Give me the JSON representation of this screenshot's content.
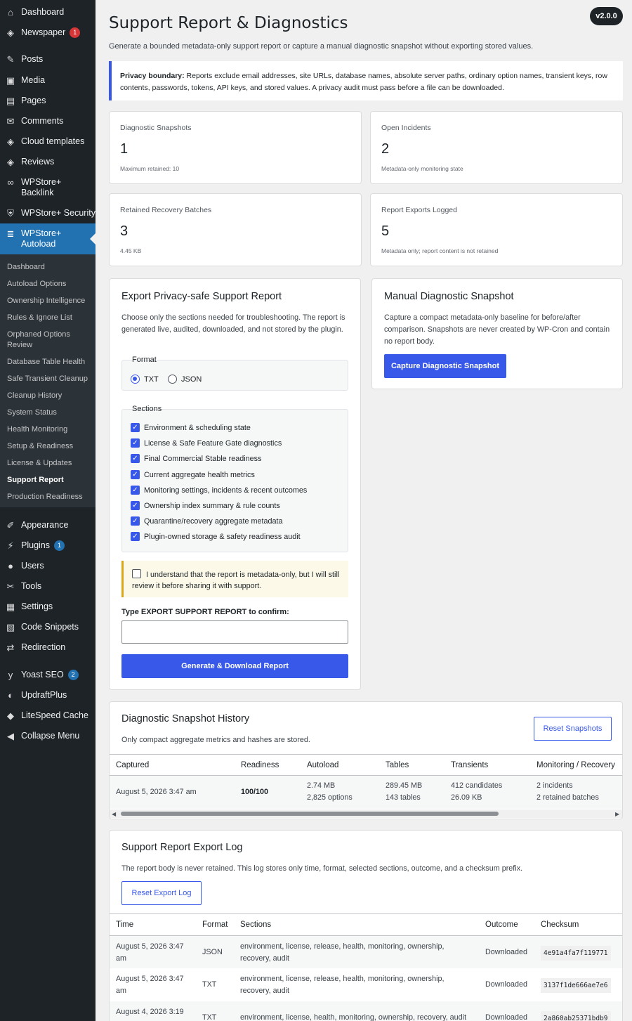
{
  "sidebar": {
    "top_items": [
      {
        "label": "Dashboard",
        "icon": "dashboard-icon",
        "glyph": "⌂"
      },
      {
        "label": "Newspaper",
        "icon": "diamond-icon",
        "glyph": "◈",
        "badge": "1"
      },
      {
        "label": "Posts",
        "icon": "pin-icon",
        "glyph": "✎"
      },
      {
        "label": "Media",
        "icon": "media-icon",
        "glyph": "▣"
      },
      {
        "label": "Pages",
        "icon": "page-icon",
        "glyph": "▤"
      },
      {
        "label": "Comments",
        "icon": "comment-icon",
        "glyph": "✉"
      },
      {
        "label": "Cloud templates",
        "icon": "diamond-icon",
        "glyph": "◈"
      },
      {
        "label": "Reviews",
        "icon": "diamond-icon",
        "glyph": "◈"
      },
      {
        "label": "WPStore+ Backlink",
        "icon": "link-icon",
        "glyph": "∞"
      },
      {
        "label": "WPStore+ Security",
        "icon": "shield-icon",
        "glyph": "⛨"
      },
      {
        "label": "WPStore+ Autoload",
        "icon": "database-icon",
        "glyph": "≣"
      }
    ],
    "submenu": [
      "Dashboard",
      "Autoload Options",
      "Ownership Intelligence",
      "Rules & Ignore List",
      "Orphaned Options Review",
      "Database Table Health",
      "Safe Transient Cleanup",
      "Cleanup History",
      "System Status",
      "Health Monitoring",
      "Setup & Readiness",
      "License & Updates",
      "Support Report",
      "Production Readiness"
    ],
    "bottom_items": [
      {
        "label": "Appearance",
        "icon": "brush-icon",
        "glyph": "✐"
      },
      {
        "label": "Plugins",
        "icon": "plug-icon",
        "glyph": "⚡",
        "badge": "1"
      },
      {
        "label": "Users",
        "icon": "user-icon",
        "glyph": "●"
      },
      {
        "label": "Tools",
        "icon": "wrench-icon",
        "glyph": "✂"
      },
      {
        "label": "Settings",
        "icon": "settings-icon",
        "glyph": "▦"
      },
      {
        "label": "Code Snippets",
        "icon": "code-icon",
        "glyph": "▧"
      },
      {
        "label": "Redirection",
        "icon": "redirect-icon",
        "glyph": "⇄"
      },
      {
        "label": "Yoast SEO",
        "icon": "yoast-icon",
        "glyph": "y",
        "badge": "2"
      },
      {
        "label": "UpdraftPlus",
        "icon": "updraft-icon",
        "glyph": "◐"
      },
      {
        "label": "LiteSpeed Cache",
        "icon": "litespeed-icon",
        "glyph": "◆"
      },
      {
        "label": "Collapse Menu",
        "icon": "collapse-icon",
        "glyph": "◀"
      }
    ]
  },
  "header": {
    "title": "Support Report & Diagnostics",
    "version": "v2.0.0",
    "subtitle": "Generate a bounded metadata-only support report or capture a manual diagnostic snapshot without exporting stored values."
  },
  "notice": {
    "bold": "Privacy boundary:",
    "text": " Reports exclude email addresses, site URLs, database names, absolute server paths, ordinary option names, transient keys, row contents, passwords, tokens, API keys, and stored values. A privacy audit must pass before a file can be downloaded."
  },
  "stats": [
    {
      "label": "Diagnostic Snapshots",
      "value": "1",
      "note": "Maximum retained: 10"
    },
    {
      "label": "Open Incidents",
      "value": "2",
      "note": "Metadata-only monitoring state"
    },
    {
      "label": "Retained Recovery Batches",
      "value": "3",
      "note": "4.45 KB"
    },
    {
      "label": "Report Exports Logged",
      "value": "5",
      "note": "Metadata only; report content is not retained"
    }
  ],
  "export": {
    "title": "Export Privacy-safe Support Report",
    "desc": "Choose only the sections needed for troubleshooting. The report is generated live, audited, downloaded, and not stored by the plugin.",
    "format_legend": "Format",
    "format_options": [
      "TXT",
      "JSON"
    ],
    "sections_legend": "Sections",
    "sections": [
      "Environment & scheduling state",
      "License & Safe Feature Gate diagnostics",
      "Final Commercial Stable readiness",
      "Current aggregate health metrics",
      "Monitoring settings, incidents & recent outcomes",
      "Ownership index summary & rule counts",
      "Quarantine/recovery aggregate metadata",
      "Plugin-owned storage & safety readiness audit"
    ],
    "confirm_text": "I understand that the report is metadata-only, but I will still review it before sharing it with support.",
    "type_label": "Type EXPORT SUPPORT REPORT to confirm:",
    "input_value": "",
    "button": "Generate & Download Report"
  },
  "snapshot": {
    "title": "Manual Diagnostic Snapshot",
    "desc": "Capture a compact metadata-only baseline for before/after comparison. Snapshots are never created by WP-Cron and contain no report body.",
    "button": "Capture Diagnostic Snapshot"
  },
  "history": {
    "title": "Diagnostic Snapshot History",
    "desc": "Only compact aggregate metrics and hashes are stored.",
    "reset_button": "Reset Snapshots",
    "columns": [
      "Captured",
      "Readiness",
      "Autoload",
      "Tables",
      "Transients",
      "Monitoring / Recovery"
    ],
    "rows": [
      {
        "captured": "August 5, 2026 3:47 am",
        "readiness": "100/100",
        "autoload_1": "2.74 MB",
        "autoload_2": "2,825 options",
        "tables_1": "289.45 MB",
        "tables_2": "143 tables",
        "transients_1": "412 candidates",
        "transients_2": "26.09 KB",
        "monitoring_1": "2 incidents",
        "monitoring_2": "2 retained batches"
      }
    ]
  },
  "log": {
    "title": "Support Report Export Log",
    "desc": "The report body is never retained. This log stores only time, format, selected sections, outcome, and a checksum prefix.",
    "reset_button": "Reset Export Log",
    "columns": [
      "Time",
      "Format",
      "Sections",
      "Outcome",
      "Checksum"
    ],
    "rows": [
      {
        "time": "August 5, 2026 3:47 am",
        "format": "JSON",
        "sections": "environment, license, release, health, monitoring, ownership, recovery, audit",
        "outcome": "Downloaded",
        "checksum": "4e91a4fa7f119771"
      },
      {
        "time": "August 5, 2026 3:47 am",
        "format": "TXT",
        "sections": "environment, license, release, health, monitoring, ownership, recovery, audit",
        "outcome": "Downloaded",
        "checksum": "3137f1de666ae7e6"
      },
      {
        "time": "August 4, 2026 3:19",
        "format": "TXT",
        "sections": "environment, license, health, monitoring, ownership, recovery, audit",
        "outcome": "Downloaded",
        "checksum": "2a860ab25371bdb9"
      }
    ]
  },
  "colors": {
    "accent": "#3858e9",
    "sidebar": "#1d2327",
    "active": "#2271b1"
  }
}
